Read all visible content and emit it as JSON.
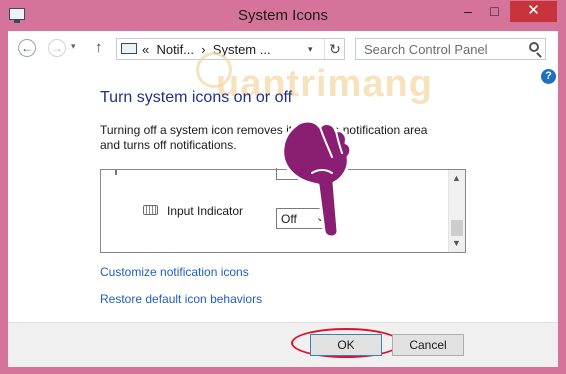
{
  "window": {
    "title": "System Icons",
    "controls": {
      "minimize": "–",
      "maximize": "□",
      "close": "✕"
    }
  },
  "nav": {
    "back": "←",
    "forward": "→",
    "dropdown": "▾",
    "up": "↑",
    "address": "«  Notif...  ›  System ...",
    "address_dropdown": "▾",
    "refresh": "↻",
    "search_placeholder": "Search Control Panel",
    "help": "?"
  },
  "watermark": "uantrimang",
  "content": {
    "heading": "Turn system icons on or off",
    "description": "Turning off a system icon removes it from the notification area and turns off notifications.",
    "list": {
      "item_name": "Input Indicator",
      "item_value": "Off",
      "dropdown_arrow": "⌄",
      "scroll_up": "▲",
      "scroll_down": "▼"
    },
    "links": {
      "customize": "Customize notification icons",
      "restore": "Restore default icon behaviors"
    }
  },
  "footer": {
    "ok": "OK",
    "cancel": "Cancel"
  },
  "colors": {
    "frame": "#d6739a",
    "heading": "#1e3287",
    "link": "#1f5fbf",
    "highlight": "#e0102a",
    "hand": "#8a1e72"
  },
  "icons": [
    "app-icon",
    "back-icon",
    "forward-icon",
    "up-arrow-icon",
    "control-panel-icon",
    "refresh-icon",
    "search-icon",
    "help-icon",
    "keyboard-icon",
    "pointing-hand-icon"
  ]
}
